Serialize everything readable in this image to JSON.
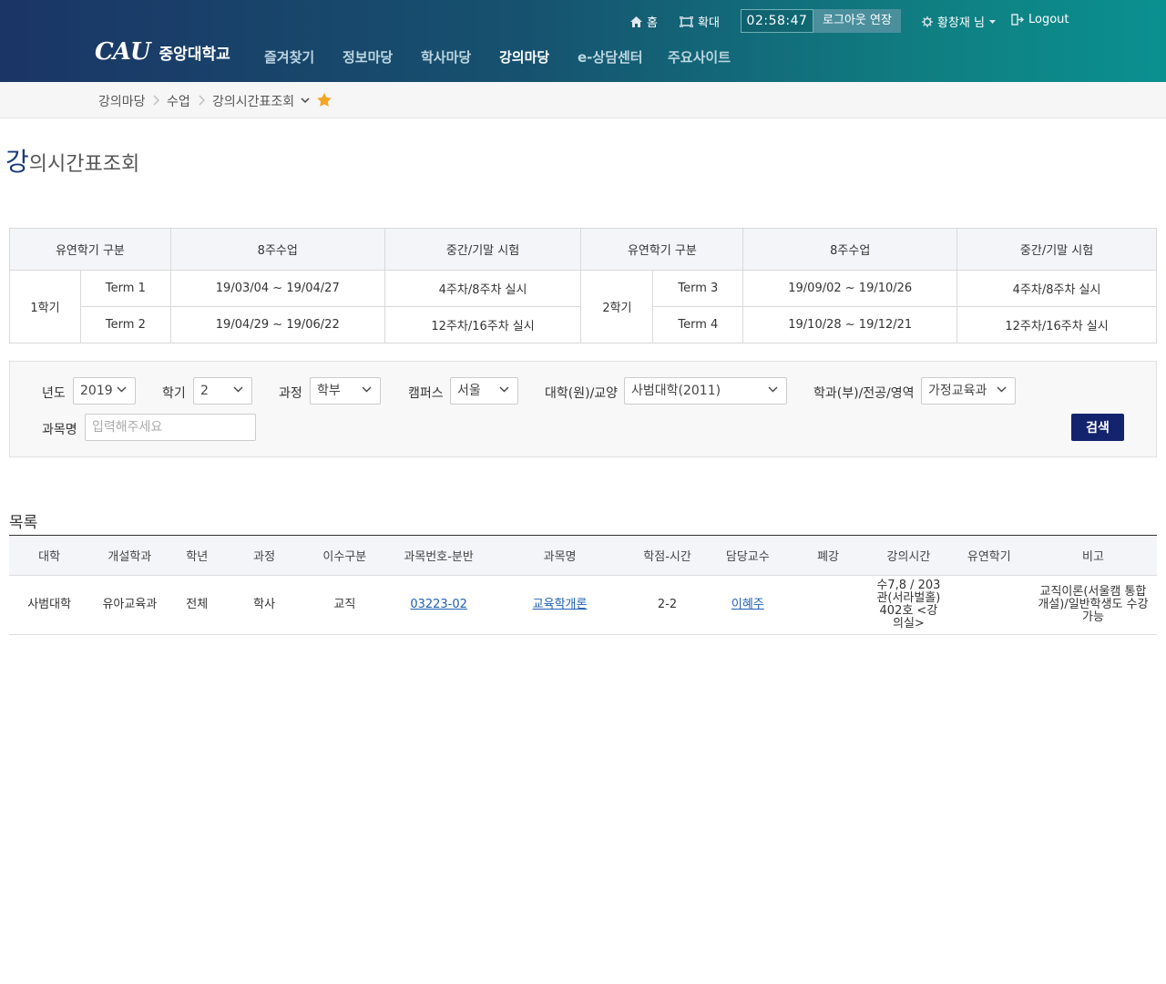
{
  "header": {
    "util": {
      "home": "홈",
      "zoom": "확대",
      "timer": "02:58:47",
      "extend": "로그아웃 연장",
      "user": "황창재 님",
      "logout": "Logout"
    },
    "logo": {
      "mark": "CAU",
      "name": "중앙대학교"
    },
    "nav": [
      "즐겨찾기",
      "정보마당",
      "학사마당",
      "강의마당",
      "e-상담센터",
      "주요사이트"
    ],
    "nav_active": "강의마당"
  },
  "breadcrumb": [
    "강의마당",
    "수업",
    "강의시간표조회"
  ],
  "page_title": {
    "first": "강",
    "rest": "의시간표조회"
  },
  "term_table": {
    "headers": [
      "유연학기 구분",
      "8주수업",
      "중간/기말 시험",
      "유연학기 구분",
      "8주수업",
      "중간/기말 시험"
    ],
    "left": {
      "semester": "1학기",
      "rows": [
        {
          "term": "Term 1",
          "period": "19/03/04 ~ 19/04/27",
          "exam": "4주차/8주차 실시"
        },
        {
          "term": "Term 2",
          "period": "19/04/29 ~ 19/06/22",
          "exam": "12주차/16주차 실시"
        }
      ]
    },
    "right": {
      "semester": "2학기",
      "rows": [
        {
          "term": "Term 3",
          "period": "19/09/02 ~ 19/10/26",
          "exam": "4주차/8주차 실시"
        },
        {
          "term": "Term 4",
          "period": "19/10/28 ~ 19/12/21",
          "exam": "12주차/16주차 실시"
        }
      ]
    }
  },
  "search": {
    "year_label": "년도",
    "year": "2019",
    "semester_label": "학기",
    "semester": "2",
    "course_label": "과정",
    "course": "학부",
    "campus_label": "캠퍼스",
    "campus": "서울",
    "college_label": "대학(원)/교양",
    "college": "사범대학(2011)",
    "dept_label": "학과(부)/전공/영역",
    "dept": "가정교육과",
    "subject_label": "과목명",
    "subject_placeholder": "입력해주세요",
    "button": "검색"
  },
  "list": {
    "title": "목록",
    "columns": [
      "대학",
      "개설학과",
      "학년",
      "과정",
      "이수구분",
      "과목번호-분반",
      "과목명",
      "학점-시간",
      "담당교수",
      "폐강",
      "강의시간",
      "유연학기",
      "비고"
    ],
    "rows": [
      {
        "college": "사범대학",
        "dept": "유아교육과",
        "grade": "전체",
        "course": "학사",
        "type": "교직",
        "code": "03223-02",
        "name": "교육학개론",
        "credit": "2-2",
        "professor": "이혜주",
        "closed": "",
        "time": "수7,8 / 203관(서라벌홀) 402호 <강의실>",
        "flex": "",
        "note": "교직이론(서울캠 통합개설)/일반학생도 수강가능"
      }
    ]
  },
  "colors": {
    "header_start": "#1b3566",
    "header_end": "#0b9090",
    "search_button": "#13236e",
    "link": "#1d5fb3",
    "star": "#f5a623"
  }
}
